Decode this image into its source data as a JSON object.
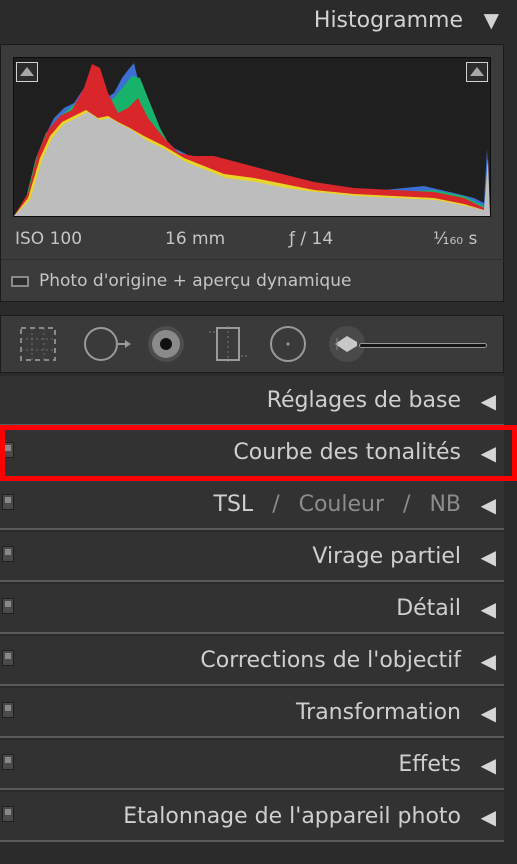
{
  "histogram": {
    "title": "Histogramme",
    "collapse_icon": "triangle-down-icon",
    "iso": "ISO 100",
    "focal": "16 mm",
    "aperture": "ƒ / 14",
    "shutter": "¹⁄₁₆₀ s",
    "preview_label": "Photo d'origine + aperçu dynamique"
  },
  "tools": [
    {
      "name": "crop-overlay-icon"
    },
    {
      "name": "spot-removal-icon"
    },
    {
      "name": "red-eye-icon"
    },
    {
      "name": "graduated-filter-icon"
    },
    {
      "name": "radial-filter-icon"
    },
    {
      "name": "adjustment-brush-icon"
    }
  ],
  "sections": {
    "basic": "Réglages de base",
    "tone_curve": "Courbe des tonalités",
    "hsl": {
      "a": "TSL",
      "sep1": "/",
      "b": "Couleur",
      "sep2": "/",
      "c": "NB"
    },
    "split_toning": "Virage partiel",
    "detail": "Détail",
    "lens": "Corrections de l'objectif",
    "transform": "Transformation",
    "effects": "Effets",
    "calibration": "Etalonnage de l'appareil photo"
  },
  "colors": {
    "highlight": "#ff0000",
    "panel": "#323232"
  }
}
